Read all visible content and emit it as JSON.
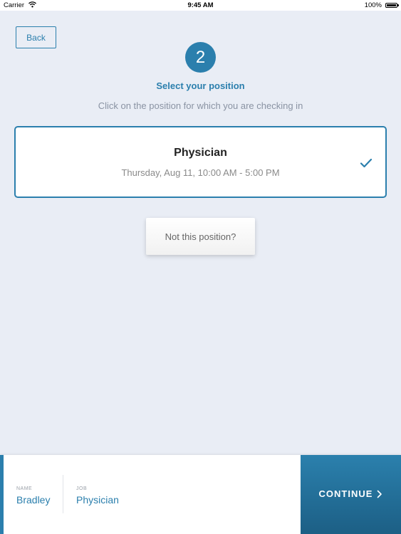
{
  "status_bar": {
    "carrier": "Carrier",
    "time": "9:45 AM",
    "battery": "100%",
    "wifi_icon": "wifi-icon",
    "battery_icon": "battery-icon"
  },
  "header": {
    "back_label": "Back",
    "step_number": "2",
    "title": "Select your position",
    "subtitle": "Click on the position for which you are checking in"
  },
  "position": {
    "title": "Physician",
    "time": "Thursday, Aug 11, 10:00 AM - 5:00 PM",
    "selected": true,
    "check_icon": "checkmark-icon"
  },
  "not_position_label": "Not this position?",
  "footer": {
    "name_label": "NAME",
    "name_value": "Bradley",
    "job_label": "JOB",
    "job_value": "Physician",
    "continue_label": "CONTINUE",
    "continue_icon": "chevron-right-icon"
  },
  "colors": {
    "accent": "#2b7fad",
    "background": "#e9edf5"
  }
}
